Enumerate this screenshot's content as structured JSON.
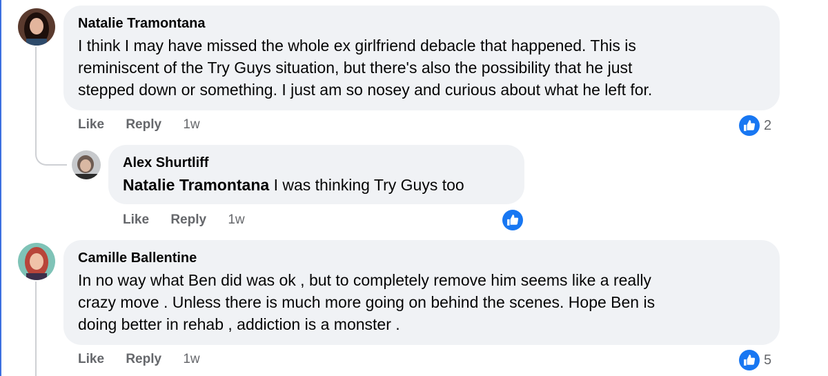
{
  "comments": [
    {
      "author": "Natalie Tramontana",
      "lines": [
        "I think I may have missed the whole ex girlfriend debacle that happened. This is",
        "reminiscent of the Try Guys situation, but there's also the possibility that he just",
        "stepped down or something. I just am so nosey and curious about what he left for."
      ],
      "like_label": "Like",
      "reply_label": "Reply",
      "time": "1w",
      "reaction_count": "2"
    },
    {
      "author": "Alex Shurtliff",
      "mention": "Natalie Tramontana",
      "text": " I was thinking Try Guys too",
      "like_label": "Like",
      "reply_label": "Reply",
      "time": "1w",
      "reaction_count": ""
    },
    {
      "author": "Camille Ballentine",
      "lines": [
        "In no way what Ben did was ok , but to completely remove him seems like a really",
        "crazy move . Unless there is much more going on behind the scenes. Hope Ben is",
        "doing better in rehab , addiction is a monster ."
      ],
      "like_label": "Like",
      "reply_label": "Reply",
      "time": "1w",
      "reaction_count": "5"
    }
  ],
  "colors": {
    "bubble": "#f0f2f5",
    "like_blue": "#1877f2",
    "meta_gray": "#65676b"
  },
  "icons": {
    "reaction": "thumbs-up-icon"
  }
}
